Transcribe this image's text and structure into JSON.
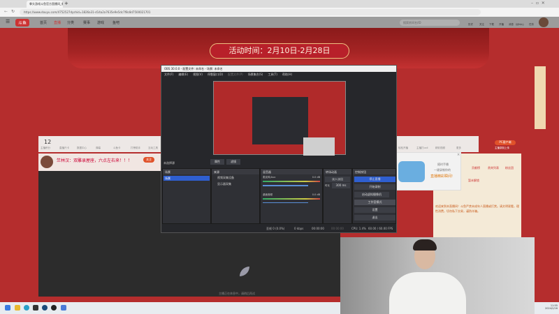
{
  "browser": {
    "tab_title": "拳头游戏斗鱼官方直播间_拳头游戏",
    "url": "https://www.douyu.com/4752527dyshid=1826a31-d14a2a7635e9e5dc7f8c8d7500021701"
  },
  "douyu": {
    "logo": "斗鱼",
    "nav": [
      "首页",
      "直播",
      "分类",
      "赛事",
      "游戏",
      "鱼吧"
    ],
    "search_placeholder": "搜索房间名/ID",
    "header_icons": [
      "历史",
      "关注",
      "下载",
      "开播",
      "消息",
      "创作中心",
      "任务"
    ]
  },
  "banner": {
    "event_time": "活动时间：2月10日-2月28日"
  },
  "toolbar": {
    "count": "12",
    "items": [
      "主播积分",
      "直播尺卡",
      "数据中心",
      "弹幕",
      "斗鱼卡",
      "打榜助手",
      "互动工具"
    ],
    "right_items": [
      "轻松开播",
      "主播打call",
      "精彩视频",
      "更多"
    ],
    "pc_button": "PC客户端",
    "pc_sub": "主播录制上传"
  },
  "room": {
    "title": "竺林汉：双雕录屋座，六点左右来！！！",
    "follow": "关注"
  },
  "video": {
    "offline_text": "主播正在休息中，请稍后再试"
  },
  "popup": {
    "line1": "随时手播",
    "line2": "一键录制你的",
    "line3": "直播精彩瞬间!"
  },
  "side": {
    "tabs": [
      "贡献榜",
      "贵宾列表",
      "粉丝团"
    ],
    "item": "暂未解锁",
    "notice": "欢迎来到本直播间！斗鱼严禁未成年人直播或打赏。请文明观看，理性消费，切勿私下交易，谨防诈骗。"
  },
  "obs": {
    "title": "OBS 30.0.0 - 配置文件: 未命名 - 场景: 未命名",
    "menu": [
      "文件(F)",
      "编辑(E)",
      "视图(V)",
      "停靠窗口(D)",
      "配置文件(P)",
      "场景集合(S)",
      "工具(T)",
      "帮助(H)"
    ],
    "no_source": "未选择源",
    "props": "属性",
    "filters": "滤镜",
    "docks": {
      "scenes": "场景",
      "sources": "来源",
      "mixer": "混音器",
      "transitions": "转场动画",
      "controls": "控制按钮"
    },
    "scene_item": "场景",
    "sources": [
      "视频采集设备",
      "显示器采集"
    ],
    "mixer": [
      {
        "name": "麦克风/Aux",
        "db": "0.0 dB"
      },
      {
        "name": "桌面音频",
        "db": "0.0 dB"
      }
    ],
    "transition": "淡入淡出",
    "duration_label": "时长",
    "duration": "300 ms",
    "controls": [
      "停止直播",
      "开始录制",
      "启动虚拟摄像机",
      "工作室模式",
      "设置",
      "退出"
    ],
    "status": {
      "dropped": "丢帧 0 (0.0%)",
      "kbps": "0 kbps",
      "live": "00:00:00",
      "rec": "00:00:00",
      "cpu": "CPU: 1.4%",
      "fps": "60.00 / 60.00 FPS"
    }
  },
  "tray": {
    "time": "11:55",
    "date": "2024/2/16"
  }
}
